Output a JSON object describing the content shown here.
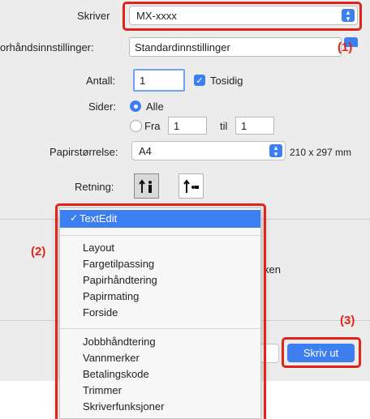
{
  "printer": {
    "label": "Skriver",
    "value": "MX-xxxx"
  },
  "presets": {
    "label": "orhåndsinnstillinger:",
    "value": "Standardinnstillinger"
  },
  "copies": {
    "label": "Antall:",
    "value": "1",
    "two_sided_label": "Tosidig",
    "two_sided_checked": true
  },
  "pages": {
    "label": "Sider:",
    "all_label": "Alle",
    "from_label": "Fra",
    "from_value": "1",
    "to_label": "til",
    "to_value": "1",
    "selected": "Alle"
  },
  "paper": {
    "label": "Papirstørrelse:",
    "value": "A4",
    "dimensions": "210 x 297 mm"
  },
  "orientation": {
    "label": "Retning:",
    "selected": "portrait"
  },
  "menu": {
    "selected": "TextEdit",
    "groups": [
      [
        "Layout",
        "Fargetilpassing",
        "Papirhåndtering",
        "Papirmating",
        "Forside"
      ],
      [
        "Jobbhåndtering",
        "Vannmerker",
        "Betalingskode",
        "Trimmer",
        "Skriverfunksjoner"
      ]
    ]
  },
  "background_text": {
    "partial_word": "ken"
  },
  "print_button": {
    "label": "Skriv ut"
  },
  "callouts": {
    "c1": "(1)",
    "c2": "(2)",
    "c3": "(3)"
  },
  "colors": {
    "accent": "#3d7ff0",
    "highlight": "#e2231a"
  },
  "icons": {
    "stepper": "chevron-up-down-icon",
    "check": "checkmark-icon",
    "portrait": "portrait-orientation-icon",
    "landscape": "landscape-orientation-icon"
  }
}
